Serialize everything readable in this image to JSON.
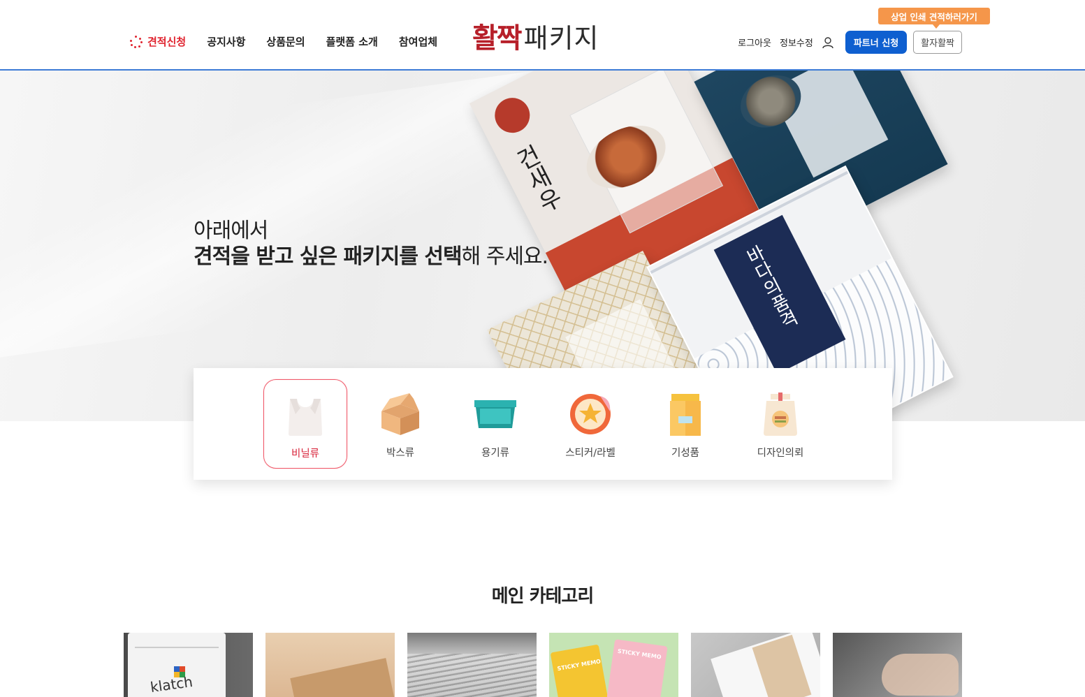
{
  "header": {
    "nav": [
      {
        "label": "견적신청",
        "active": true
      },
      {
        "label": "공지사항",
        "active": false
      },
      {
        "label": "상품문의",
        "active": false
      },
      {
        "label": "플랫폼 소개",
        "active": false
      },
      {
        "label": "참여업체",
        "active": false
      }
    ],
    "logo_red": "활짝",
    "logo_dark": "패키지",
    "logout": "로그아웃",
    "edit_profile": "정보수정",
    "user_icon": "user-icon",
    "partner_button": "파트너 신청",
    "hwalja_button": "활자활짝",
    "promo_tag": "상업 인쇄 견적하러가기",
    "accent_color": "#e0242f",
    "primary_button_color": "#0e5fd0",
    "promo_color": "#f5964a"
  },
  "hero": {
    "line1": "아래에서",
    "line2_bold_1": "견적을 받고 싶은 패키지를 선택",
    "line2_rest": "해 주세요.",
    "pack1_title": "건새우",
    "pack3_title": "바다의품격"
  },
  "categories": [
    {
      "label": "비닐류",
      "icon": "plastic-bag-icon",
      "active": true
    },
    {
      "label": "박스류",
      "icon": "box-icon",
      "active": false
    },
    {
      "label": "용기류",
      "icon": "container-icon",
      "active": false
    },
    {
      "label": "스티커/라벨",
      "icon": "sticker-icon",
      "active": false
    },
    {
      "label": "기성품",
      "icon": "ready-made-bag-icon",
      "active": false
    },
    {
      "label": "디자인의뢰",
      "icon": "design-request-icon",
      "active": false
    }
  ],
  "main_category": {
    "title": "메인 카테고리",
    "thumb1_brand": "klatch",
    "thumb4_memo": "STICKY MEMO"
  }
}
